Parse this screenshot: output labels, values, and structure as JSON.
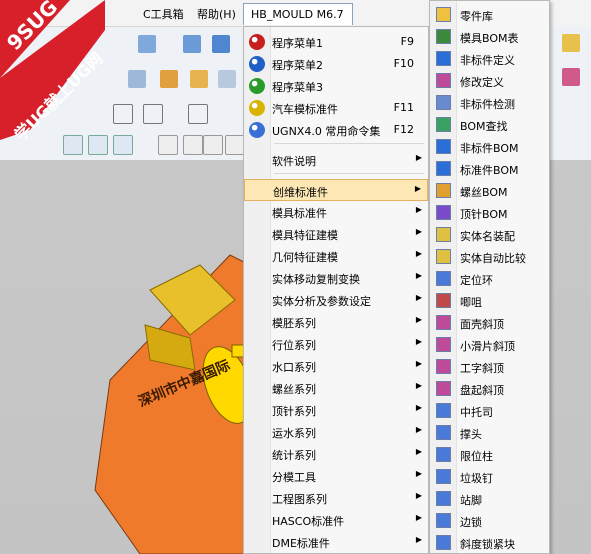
{
  "menubar": {
    "tools_label": "C工具箱",
    "help_label": "帮助(H)",
    "hb_title": "HB_MOULD M6.7"
  },
  "logo": {
    "line1": "9SUG",
    "line2": "学UG就上UG网"
  },
  "part_label": "深圳市中嘉国际",
  "main_menu": [
    {
      "label": "程序菜单1",
      "shortcut": "F9",
      "icon": "yin-yang-icon",
      "color": "#c81e1e"
    },
    {
      "label": "程序菜单2",
      "shortcut": "F10",
      "icon": "yin-yang-icon",
      "color": "#1e5fc8"
    },
    {
      "label": "程序菜单3",
      "shortcut": "",
      "icon": "yin-yang-icon",
      "color": "#2a9a2a"
    },
    {
      "label": "汽车模标准件",
      "shortcut": "F11",
      "icon": "yin-yang-icon",
      "color": "#d8b400"
    },
    {
      "label": "UGNX4.0 常用命令集",
      "shortcut": "F12",
      "icon": "ug-icon",
      "color": "#3a6fd8"
    },
    {
      "label": "软件说明",
      "shortcut": "",
      "submenu": true
    },
    {
      "label": "创维标准件",
      "shortcut": "",
      "submenu": true,
      "highlighted": true
    },
    {
      "label": "模具标准件",
      "submenu": true
    },
    {
      "label": "模具特征建模",
      "submenu": true
    },
    {
      "label": "几何特征建模",
      "submenu": true
    },
    {
      "label": "实体移动复制变换",
      "submenu": true
    },
    {
      "label": "实体分析及参数设定",
      "submenu": true
    },
    {
      "label": "模胚系列",
      "submenu": true
    },
    {
      "label": "行位系列",
      "submenu": true
    },
    {
      "label": "水口系列",
      "submenu": true
    },
    {
      "label": "螺丝系列",
      "submenu": true
    },
    {
      "label": "顶针系列",
      "submenu": true
    },
    {
      "label": "运水系列",
      "submenu": true
    },
    {
      "label": "统计系列",
      "submenu": true
    },
    {
      "label": "分模工具",
      "submenu": true
    },
    {
      "label": "工程图系列",
      "submenu": true
    },
    {
      "label": "HASCO标准件",
      "submenu": true
    },
    {
      "label": "DME标准件",
      "submenu": true
    }
  ],
  "sub_menu": [
    "零件库",
    "模具BOM表",
    "非标件定义",
    "修改定义",
    "非标件检测",
    "BOM查找",
    "非标件BOM",
    "标准件BOM",
    "螺丝BOM",
    "顶针BOM",
    "实体名装配",
    "实体自动比较",
    "定位环",
    "唧咀",
    "面壳斜顶",
    "小滑片斜顶",
    "工字斜顶",
    "盘起斜顶",
    "中托司",
    "撑头",
    "限位柱",
    "垃圾钉",
    "站脚",
    "边锁",
    "斜度锁紧块"
  ]
}
